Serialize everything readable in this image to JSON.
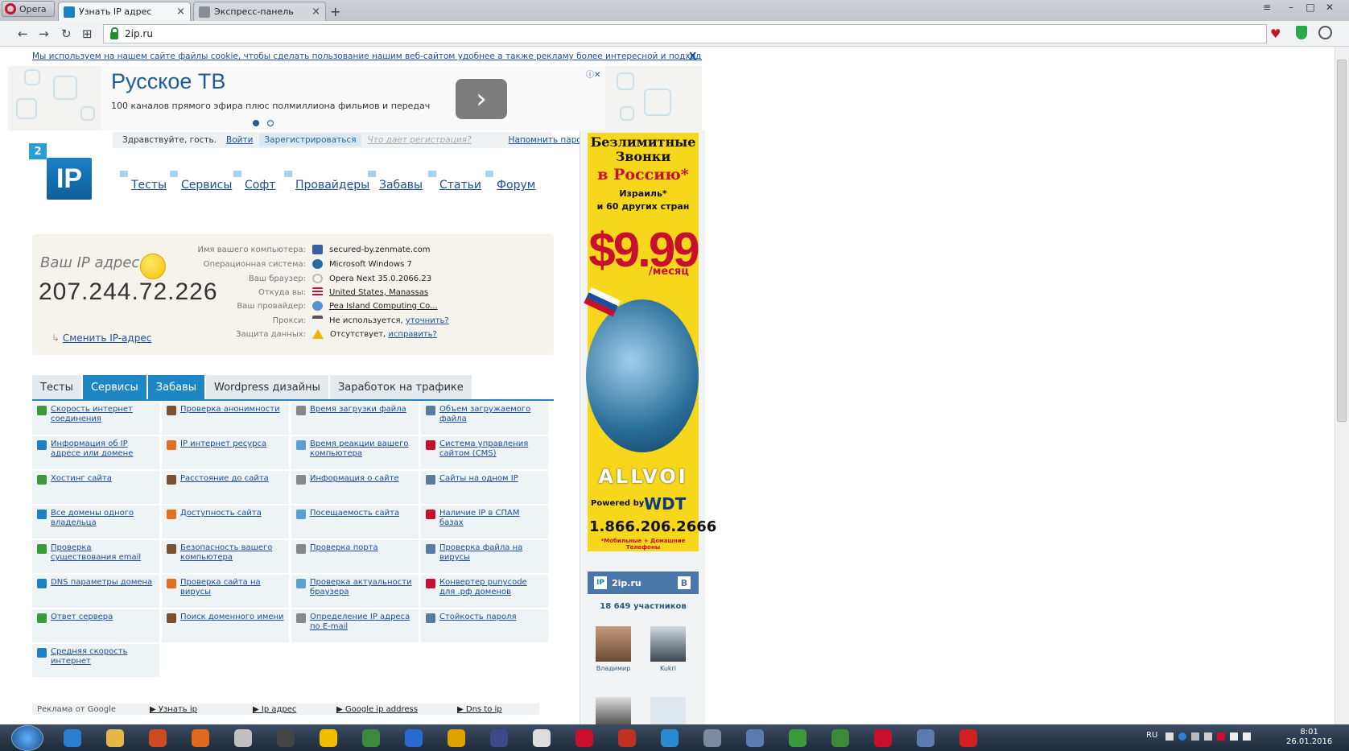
{
  "browser": {
    "menu_label": "Opera",
    "tabs": [
      {
        "title": "Узнать IP адрес",
        "close": "×"
      },
      {
        "title": "Экспресс-панель",
        "close": "×"
      }
    ],
    "new_tab": "+",
    "window_controls": {
      "minimize": "–",
      "maximize": "□",
      "close": "✕"
    },
    "nav": {
      "back": "←",
      "forward": "→",
      "reload": "↻",
      "apps": "⊞"
    },
    "url": "2ip.ru"
  },
  "cookie_notice": {
    "text": "Мы используем на нашем сайте файлы cookie, чтобы сделать пользование нашим веб-сайтом удобнее а также рекламу более интересной и подходящей для вас.",
    "close": "X"
  },
  "top_ad": {
    "title": "Русское ТВ",
    "subtitle": "100 каналов прямого эфира плюс полмиллиона фильмов и передач",
    "arrow": "›",
    "close_label": "ⓘ✕"
  },
  "login_bar": {
    "greeting": "Здравствуйте, гость.",
    "login": "Войти",
    "register": "Зарегистрироваться",
    "what": "Что дает регистрация?",
    "remind": "Напомнить пароль"
  },
  "logo": {
    "badge": "2",
    "text": "IP"
  },
  "main_nav": [
    "Тесты",
    "Сервисы",
    "Софт",
    "Провайдеры",
    "Забавы",
    "Статьи",
    "Форум"
  ],
  "ip_block": {
    "label": "Ваш IP адрес:",
    "ip": "207.244.72.226",
    "change_link": "Сменить IP-адрес",
    "rows": [
      {
        "key": "Имя вашего компьютера:",
        "value": "secured-by.zenmate.com",
        "link": false
      },
      {
        "key": "Операционная система:",
        "value": "Microsoft Windows 7",
        "link": false
      },
      {
        "key": "Ваш браузер:",
        "value": "Opera Next 35.0.2066.23",
        "link": false
      },
      {
        "key": "Откуда вы:",
        "value": "United States, Manassas",
        "link": true
      },
      {
        "key": "Ваш провайдер:",
        "value": "Pea Island Computing Co...",
        "link": true
      },
      {
        "key": "Прокси:",
        "value": "Не используется,",
        "extra": "уточнить?",
        "link": false
      },
      {
        "key": "Защита данных:",
        "value": "Отсутствует,",
        "extra": "исправить?",
        "link": false
      }
    ]
  },
  "content_tabs": [
    {
      "label": "Тесты",
      "style": "grey"
    },
    {
      "label": "Сервисы",
      "style": "blue"
    },
    {
      "label": "Забавы",
      "style": "blue"
    },
    {
      "label": "Wordpress дизайны",
      "style": "grey"
    },
    {
      "label": "Заработок на трафике",
      "style": "grey"
    }
  ],
  "services": [
    [
      "Скорость интернет соединения",
      "Проверка анонимности",
      "Время загрузки файла",
      "Объем загружаемого файла"
    ],
    [
      "Информация об IP адресе или домене",
      "IP интернет ресурса",
      "Время реакции вашего компьютера",
      "Система управления сайтом (CMS)"
    ],
    [
      "Хостинг сайта",
      "Расстояние до сайта",
      "Информация о сайте",
      "Сайты на одном IP"
    ],
    [
      "Все домены одного владельца",
      "Доступность сайта",
      "Посещаемость сайта",
      "Наличие IP в СПАМ базах"
    ],
    [
      "Проверка существования email",
      "Безопасность вашего компьютера",
      "Проверка порта",
      "Проверка файла на вирусы"
    ],
    [
      "DNS параметры домена",
      "Проверка сайта на вирусы",
      "Проверка актуальности браузера",
      "Конвертер punycode для .рф доменов"
    ],
    [
      "Ответ сервера",
      "Поиск доменного имени",
      "Определение IP адреса по E-mail",
      "Стойкость пароля"
    ],
    [
      "Средняя скорость интернет"
    ]
  ],
  "bottom_ads": {
    "label": "Реклама от Google",
    "links": [
      "▶ Узнать ip",
      "▶ Ip адрес",
      "▶ Google ip address",
      "▶ Dns to ip"
    ]
  },
  "right_ad": {
    "line1": "Безлимитные Звонки",
    "line2": "в Россию*",
    "line3": "Израиль*",
    "line4": "и 60 других стран",
    "price": "$9.99",
    "per": "/месяц",
    "brand": "ALLVOI",
    "powered": "Powered by",
    "wdt": "WDT",
    "phone": "1.866.206.2666",
    "footnote": "*Мобильные + Домашние Телефоны"
  },
  "vk_widget": {
    "site": "2ip.ru",
    "badge": "IP",
    "vk": "В",
    "members": "18 649 участников",
    "people": [
      "Владимир",
      "Kukri"
    ]
  },
  "taskbar": {
    "lang": "RU",
    "time": "8:01",
    "date": "26.01.2016"
  }
}
